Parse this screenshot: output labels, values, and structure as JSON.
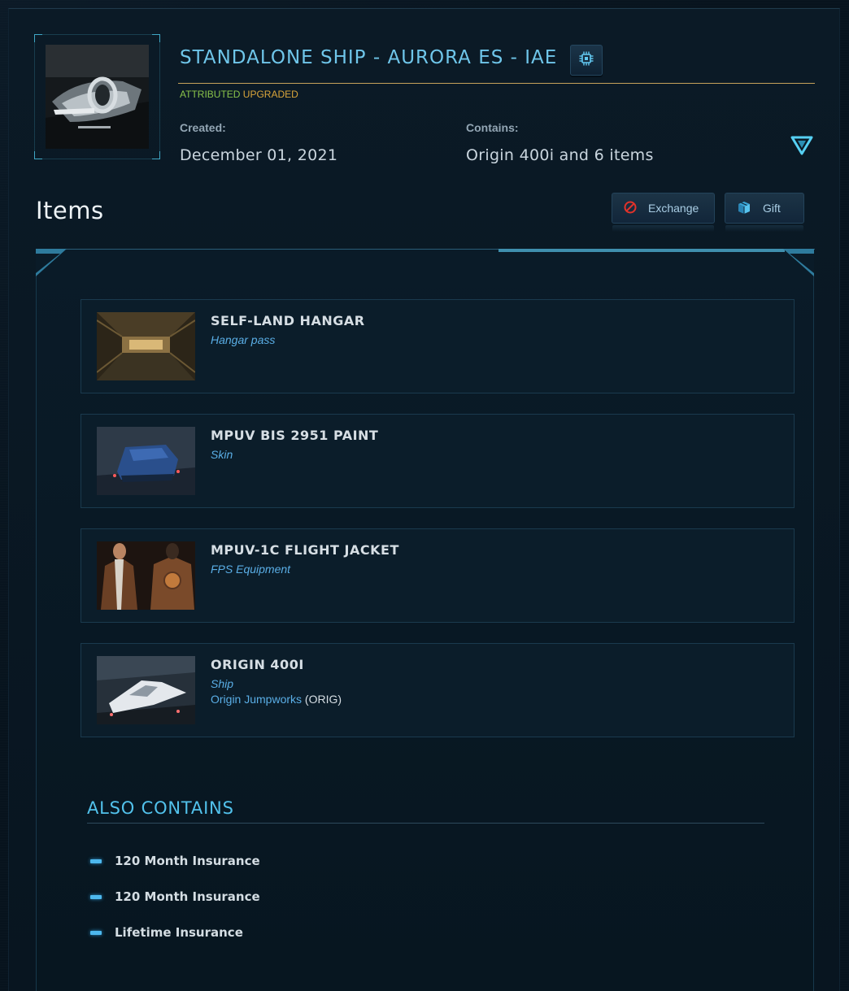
{
  "pledge": {
    "title": "STANDALONE SHIP - AURORA ES - IAE",
    "thumbnail_alt": "Origin 400i ship image",
    "chip_icon": "chip-icon",
    "tags": {
      "attributed": "ATTRIBUTED",
      "upgraded": "UPGRADED"
    },
    "created_label": "Created:",
    "created_value": "December 01, 2021",
    "contains_label": "Contains:",
    "contains_value": "Origin 400i and 6 items",
    "expand_icon": "triangle-down-icon"
  },
  "items_section": {
    "heading": "Items",
    "buttons": {
      "exchange": "Exchange",
      "gift": "Gift"
    }
  },
  "items": [
    {
      "name": "SELF-LAND HANGAR",
      "type": "Hangar pass"
    },
    {
      "name": "MPUV BIS 2951 PAINT",
      "type": "Skin"
    },
    {
      "name": "MPUV-1C FLIGHT JACKET",
      "type": "FPS Equipment"
    },
    {
      "name": "ORIGIN 400I",
      "type": "Ship",
      "manufacturer": "Origin Jumpworks",
      "manufacturer_code": "(ORIG)"
    }
  ],
  "also_contains": {
    "heading": "ALSO CONTAINS",
    "entries": [
      "120 Month Insurance",
      "120 Month Insurance",
      "Lifetime Insurance"
    ]
  },
  "colors": {
    "accent": "#6fc6ea",
    "attributed": "#89c34a",
    "upgraded": "#d9a53b",
    "item_type": "#5aaee6",
    "gold_rule": "#c7a25a"
  }
}
